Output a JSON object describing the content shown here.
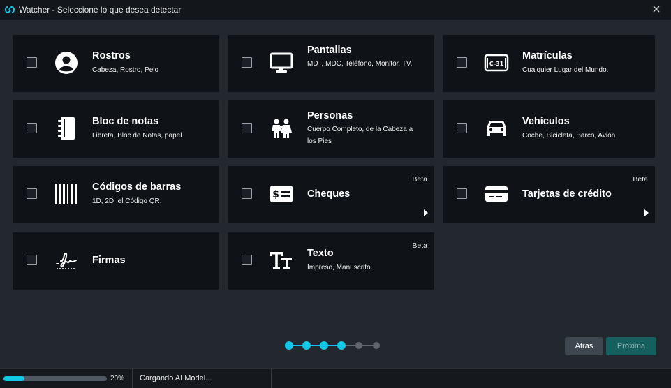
{
  "window": {
    "title": "Watcher - Seleccione lo que desea detectar",
    "icon": "watcher-logo-icon",
    "close_icon": "close-icon"
  },
  "cards": [
    {
      "id": "rostros",
      "title": "Rostros",
      "desc": "Cabeza, Rostro, Pelo",
      "icon": "face-icon",
      "beta": "",
      "checked": false
    },
    {
      "id": "pantallas",
      "title": "Pantallas",
      "desc": "MDT, MDC, Teléfono, Monitor, TV.",
      "icon": "monitor-icon",
      "beta": "",
      "checked": false
    },
    {
      "id": "matriculas",
      "title": "Matrículas",
      "desc": "Cualquier Lugar del Mundo.",
      "icon": "license-plate-icon",
      "plate_text": "C-31",
      "beta": "",
      "checked": false
    },
    {
      "id": "bloc",
      "title": "Bloc de notas",
      "desc": "Libreta, Bloc de Notas, papel",
      "icon": "notebook-icon",
      "beta": "",
      "checked": false
    },
    {
      "id": "personas",
      "title": "Personas",
      "desc": "Cuerpo Completo, de la Cabeza a los Pies",
      "icon": "people-icon",
      "beta": "",
      "checked": false
    },
    {
      "id": "vehiculos",
      "title": "Vehículos",
      "desc": "Coche, Bicicleta, Barco, Avión",
      "icon": "car-icon",
      "beta": "",
      "checked": false
    },
    {
      "id": "codigos",
      "title": "Códigos de barras",
      "desc": "1D, 2D, el Código QR.",
      "icon": "barcode-icon",
      "beta": "",
      "checked": false
    },
    {
      "id": "cheques",
      "title": "Cheques",
      "desc": "",
      "icon": "cheque-icon",
      "beta": "Beta",
      "checked": false
    },
    {
      "id": "tarjetas",
      "title": "Tarjetas de crédito",
      "desc": "",
      "icon": "credit-card-icon",
      "beta": "Beta",
      "checked": false
    },
    {
      "id": "firmas",
      "title": "Firmas",
      "desc": "",
      "icon": "signature-icon",
      "beta": "",
      "checked": false
    },
    {
      "id": "texto",
      "title": "Texto",
      "desc": "Impreso, Manuscrito.",
      "icon": "text-icon",
      "beta": "Beta",
      "checked": false
    }
  ],
  "stepper": {
    "total": 6,
    "current": 4,
    "active_color": "#12c8e6",
    "inactive_color": "#62676f"
  },
  "buttons": {
    "back": "Atrás",
    "next": "Próxima"
  },
  "status": {
    "progress": 0.2,
    "percent_label": "20%",
    "message": "Cargando AI Model..."
  },
  "colors": {
    "accent": "#12c8e6",
    "card_bg": "#0f1216",
    "window_bg": "#23272e",
    "next_button": "#15605f"
  }
}
